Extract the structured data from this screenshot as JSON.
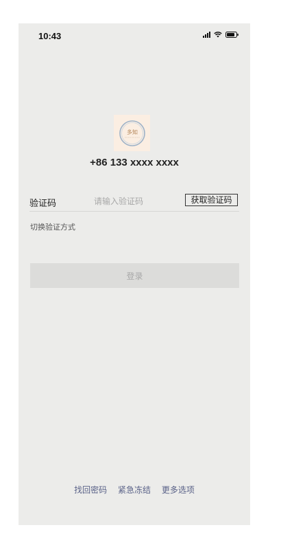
{
  "status_bar": {
    "time": "10:43"
  },
  "account": {
    "logo_text": "多知",
    "phone": "+86 133 xxxx xxxx"
  },
  "form": {
    "code_label": "验证码",
    "code_placeholder": "请输入验证码",
    "get_code_label": "获取验证码",
    "switch_method_label": "切换验证方式",
    "login_label": "登录"
  },
  "footer": {
    "links": [
      "找回密码",
      "紧急冻结",
      "更多选项"
    ]
  },
  "colors": {
    "screen_bg": "#ececea",
    "logo_bg": "#fbeee2",
    "button_disabled_bg": "#dcdcda",
    "link_color": "#5a6288"
  }
}
